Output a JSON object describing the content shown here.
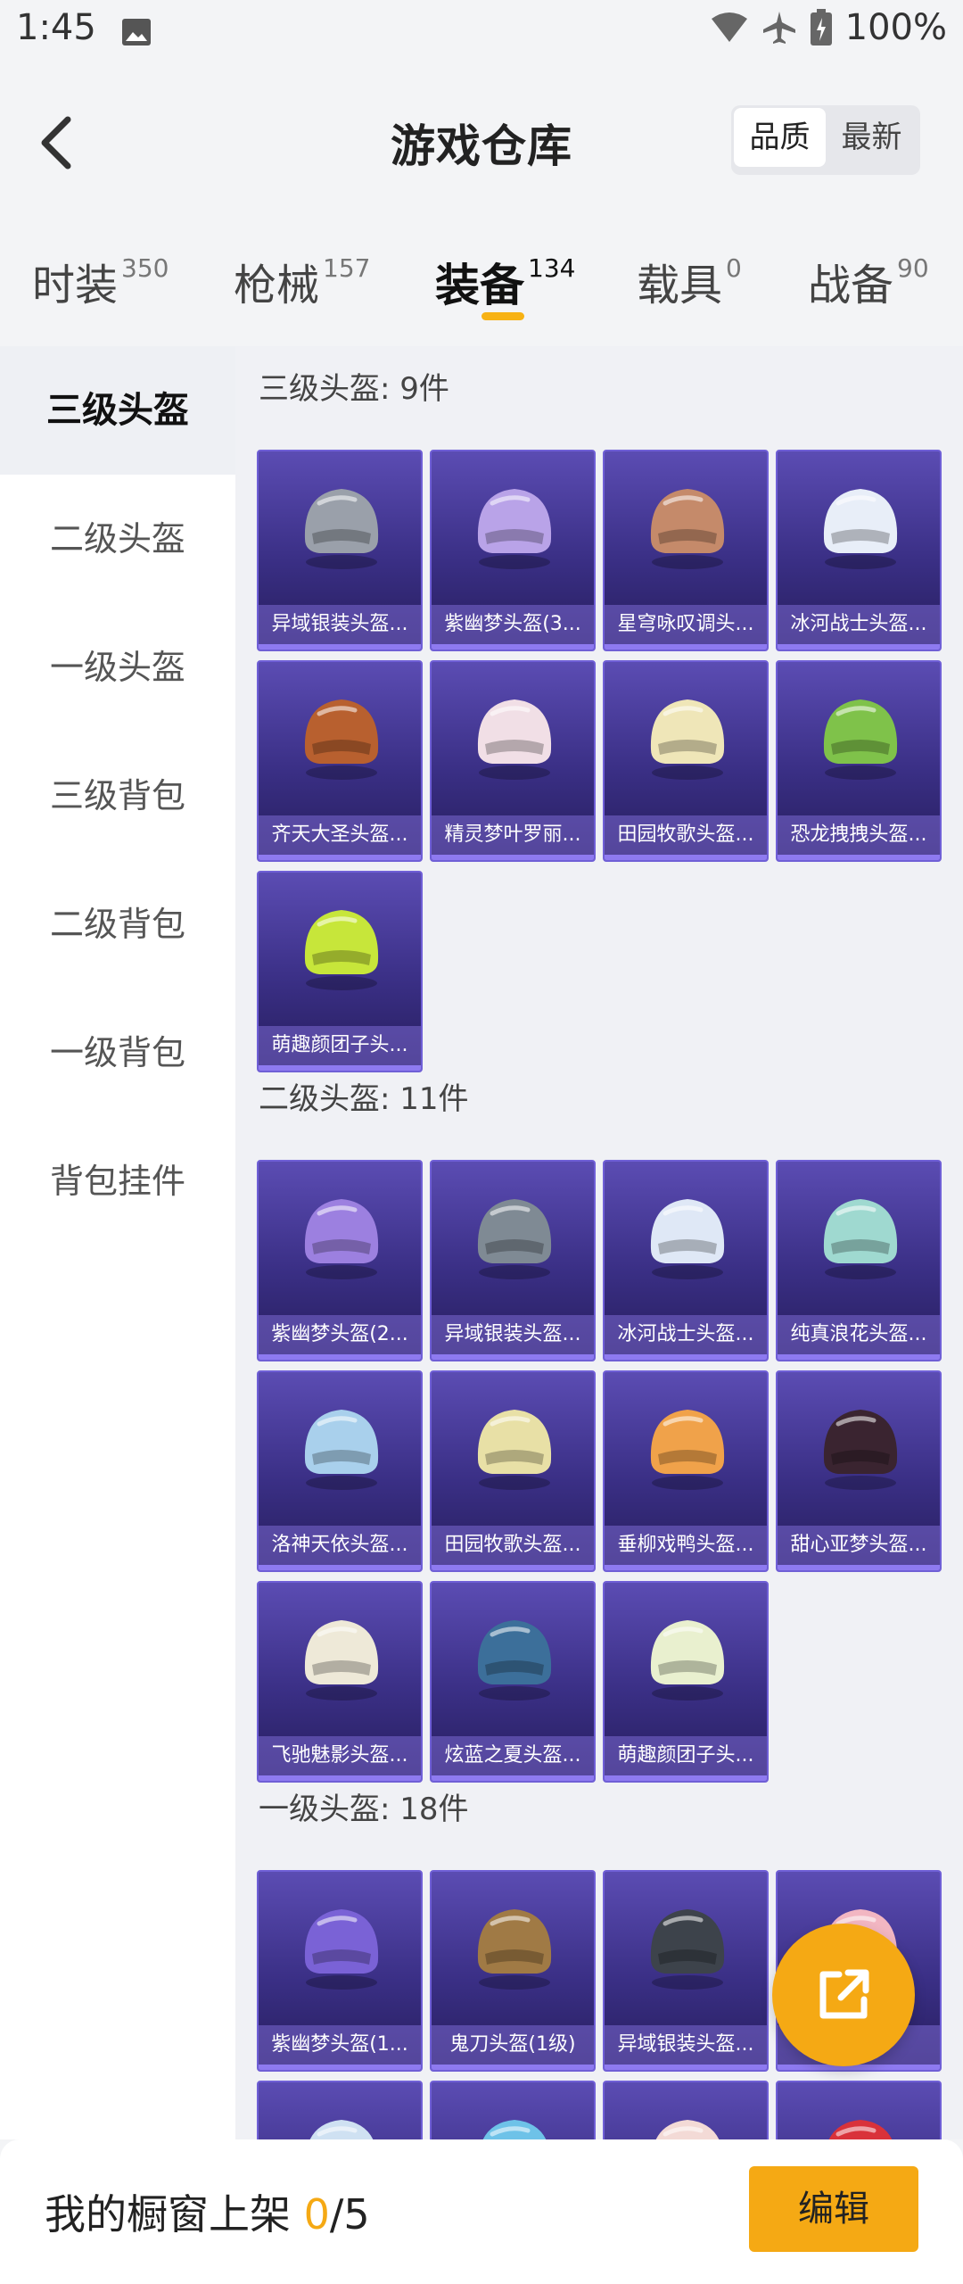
{
  "status_bar": {
    "time": "1:45",
    "battery": "100%"
  },
  "header": {
    "title": "游戏仓库",
    "sort_options": [
      "品质",
      "最新"
    ],
    "sort_active": "品质"
  },
  "tabs": [
    {
      "label": "时装",
      "count": "350"
    },
    {
      "label": "枪械",
      "count": "157"
    },
    {
      "label": "装备",
      "count": "134",
      "active": true
    },
    {
      "label": "载具",
      "count": "0"
    },
    {
      "label": "战备",
      "count": "90"
    }
  ],
  "sidebar": {
    "items": [
      {
        "label": "三级头盔",
        "active": true
      },
      {
        "label": "二级头盔"
      },
      {
        "label": "一级头盔"
      },
      {
        "label": "三级背包"
      },
      {
        "label": "二级背包"
      },
      {
        "label": "一级背包"
      },
      {
        "label": "背包挂件"
      }
    ]
  },
  "sections": [
    {
      "title": "三级头盔: 9件",
      "items": [
        {
          "name": "异域银装头盔...",
          "color": "#9aa0aa"
        },
        {
          "name": "紫幽梦头盔(3...",
          "color": "#b9a3e8"
        },
        {
          "name": "星穹咏叹调头...",
          "color": "#c58a6a"
        },
        {
          "name": "冰河战士头盔...",
          "color": "#e8eef8"
        },
        {
          "name": "齐天大圣头盔...",
          "color": "#b8602f"
        },
        {
          "name": "精灵梦叶罗丽...",
          "color": "#f1dfe6"
        },
        {
          "name": "田园牧歌头盔...",
          "color": "#efe6b8"
        },
        {
          "name": "恐龙拽拽头盔...",
          "color": "#7fc24a"
        },
        {
          "name": "萌趣颜团子头...",
          "color": "#c7e63a"
        }
      ]
    },
    {
      "title": "二级头盔: 11件",
      "items": [
        {
          "name": "紫幽梦头盔(2...",
          "color": "#9c80e0"
        },
        {
          "name": "异域银装头盔...",
          "color": "#7f8a94"
        },
        {
          "name": "冰河战士头盔...",
          "color": "#dfe8f6"
        },
        {
          "name": "纯真浪花头盔...",
          "color": "#9fd9d0"
        },
        {
          "name": "洛神天依头盔...",
          "color": "#a9d0ec"
        },
        {
          "name": "田园牧歌头盔...",
          "color": "#e8e0a6"
        },
        {
          "name": "垂柳戏鸭头盔...",
          "color": "#f0a24a"
        },
        {
          "name": "甜心亚梦头盔...",
          "color": "#3a2430"
        },
        {
          "name": "飞驰魅影头盔...",
          "color": "#eee9d8"
        },
        {
          "name": "炫蓝之夏头盔...",
          "color": "#3c6f9a"
        },
        {
          "name": "萌趣颜团子头...",
          "color": "#e9f0cf"
        }
      ]
    },
    {
      "title": "一级头盔: 18件",
      "items": [
        {
          "name": "紫幽梦头盔(1...",
          "color": "#7a62d6"
        },
        {
          "name": "鬼刀头盔(1级)",
          "color": "#a07a45"
        },
        {
          "name": "异域银装头盔...",
          "color": "#3d434b"
        },
        {
          "name": "",
          "color": "#f2b6c2"
        },
        {
          "name": "",
          "color": "#cfe1f2"
        },
        {
          "name": "",
          "color": "#6ec2e8"
        },
        {
          "name": "",
          "color": "#f3dad6"
        },
        {
          "name": "",
          "color": "#d9323a"
        }
      ]
    }
  ],
  "bottom_bar": {
    "label_prefix": "我的橱窗上架 ",
    "current": "0",
    "total": "/5",
    "edit_label": "编辑"
  }
}
